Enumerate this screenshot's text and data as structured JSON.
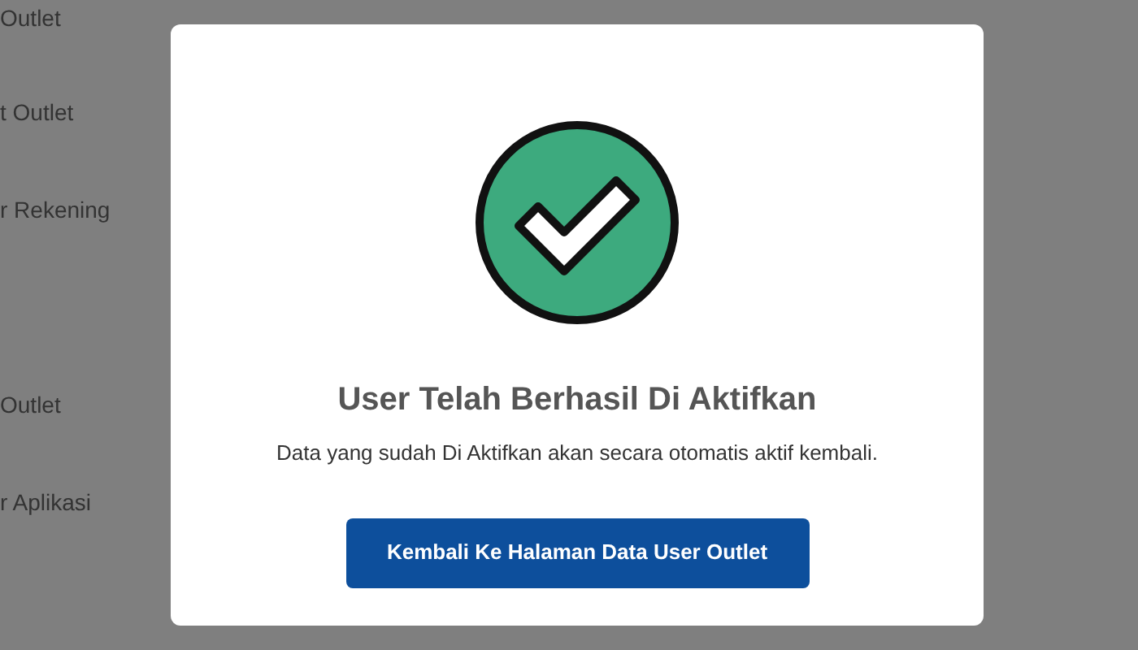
{
  "sidebar": {
    "items": [
      {
        "label": "Outlet"
      },
      {
        "label": "t Outlet"
      },
      {
        "label": "r Rekening"
      },
      {
        "label": "Outlet"
      },
      {
        "label": "r Aplikasi"
      }
    ]
  },
  "dialog": {
    "title": "User Telah Berhasil Di Aktifkan",
    "message": "Data yang sudah Di Aktifkan akan secara otomatis aktif kembali.",
    "button": "Kembali Ke Halaman Data User Outlet"
  }
}
